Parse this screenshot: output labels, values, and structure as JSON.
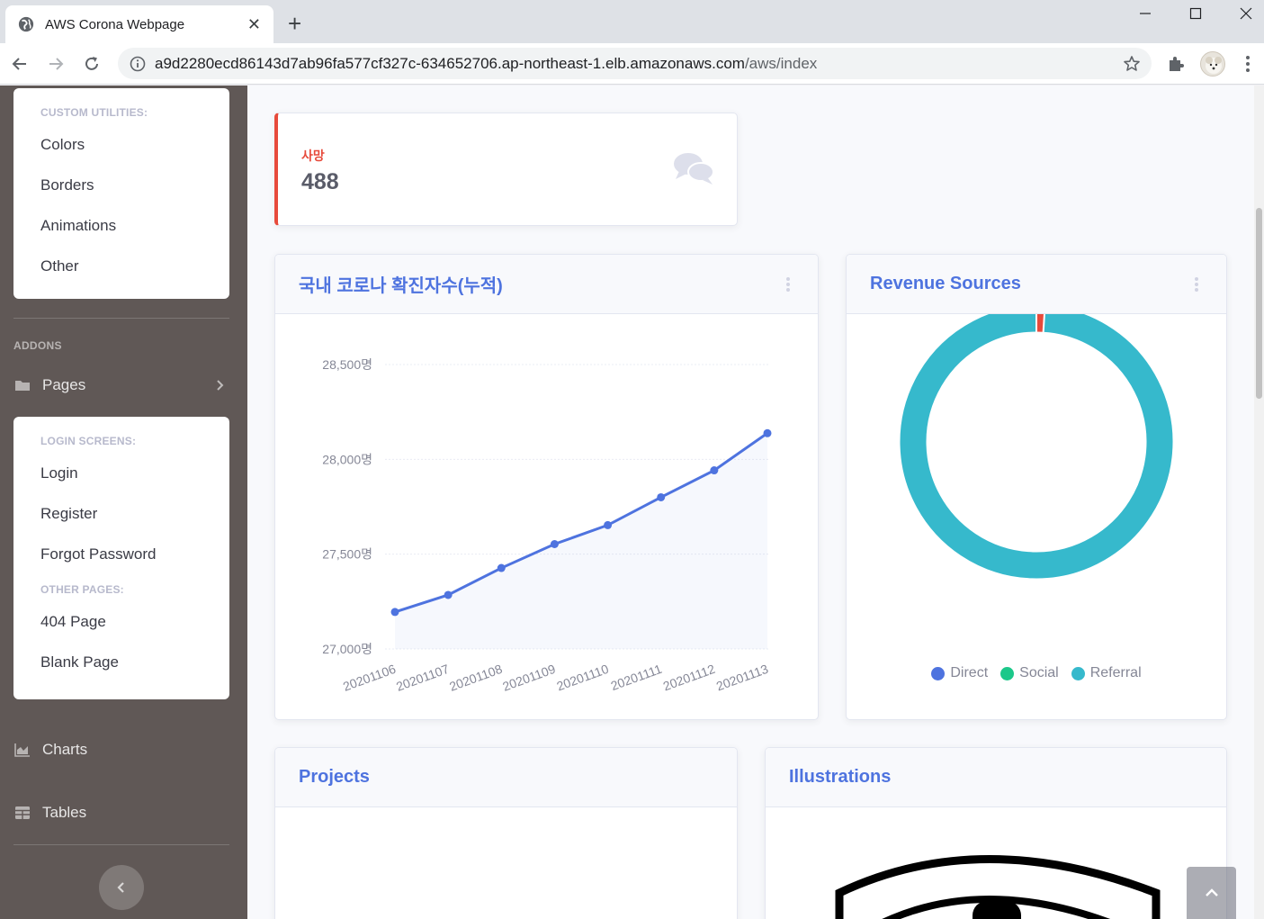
{
  "browser": {
    "tab_title": "AWS Corona Webpage",
    "url_host": "a9d2280ecd86143d7ab96fa577cf327c-634652706.ap-northeast-1.elb.amazonaws.com",
    "url_path": "/aws/index"
  },
  "sidebar": {
    "utilities": {
      "header": "CUSTOM UTILITIES:",
      "items": [
        "Colors",
        "Borders",
        "Animations",
        "Other"
      ]
    },
    "addons_heading": "ADDONS",
    "pages_link": "Pages",
    "pages_menu": {
      "login_header": "LOGIN SCREENS:",
      "login_items": [
        "Login",
        "Register",
        "Forgot Password"
      ],
      "other_header": "OTHER PAGES:",
      "other_items": [
        "404 Page",
        "Blank Page"
      ]
    },
    "charts_link": "Charts",
    "tables_link": "Tables"
  },
  "stat": {
    "label": "사망",
    "value": "488"
  },
  "area_card": {
    "title": "국내 코로나 확진자수(누적)"
  },
  "pie_card": {
    "title": "Revenue Sources"
  },
  "projects_card": {
    "title": "Projects"
  },
  "illustrations_card": {
    "title": "Illustrations"
  },
  "colors": {
    "primary": "#4e73df",
    "success": "#1cc88a",
    "info": "#36b9cc",
    "danger": "#e74a3b",
    "sidebar_bg": "#605856"
  },
  "chart_data": [
    {
      "type": "area",
      "title": "국내 코로나 확진자수(누적)",
      "x": [
        "20201106",
        "20201107",
        "20201108",
        "20201109",
        "20201110",
        "20201111",
        "20201112",
        "20201113"
      ],
      "values": [
        27195,
        27285,
        27427,
        27553,
        27653,
        27800,
        27942,
        28138
      ],
      "ylim": [
        27000,
        28500
      ],
      "yticks": [
        27000,
        27500,
        28000,
        28500
      ],
      "ytick_labels": [
        "27,000명",
        "27,500명",
        "28,000명",
        "28,500명"
      ],
      "grid": true
    },
    {
      "type": "pie",
      "title": "Revenue Sources",
      "labels": [
        "Direct",
        "Social",
        "Referral"
      ],
      "values": [
        0,
        1,
        99
      ],
      "colors": [
        "#4e73df",
        "#1cc88a",
        "#36b9cc"
      ],
      "slice_colors_drawn": [
        "#e74a3b",
        "#36b9cc"
      ],
      "legend": "bottom"
    }
  ]
}
